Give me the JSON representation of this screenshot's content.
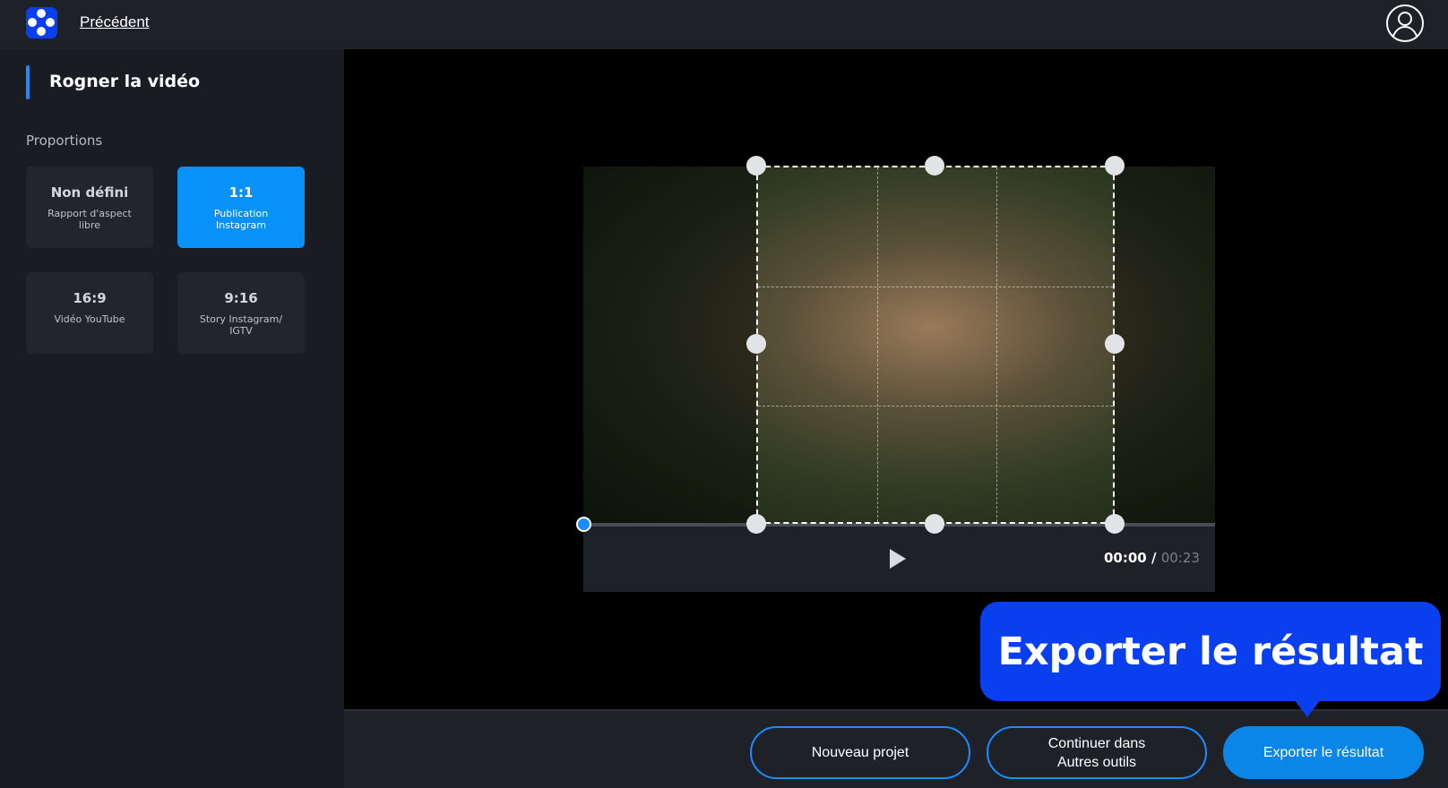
{
  "header": {
    "back_label": "Précédent"
  },
  "sidebar": {
    "title": "Rogner la vidéo",
    "section_label": "Proportions",
    "options": [
      {
        "ratio": "Non défini",
        "desc": "Rapport d'aspect libre",
        "selected": false
      },
      {
        "ratio": "1:1",
        "desc": "Publication Instagram",
        "selected": true
      },
      {
        "ratio": "16:9",
        "desc": "Vidéo YouTube",
        "selected": false
      },
      {
        "ratio": "9:16",
        "desc": "Story Instagram/ IGTV",
        "selected": false
      }
    ]
  },
  "player": {
    "current_time": "00:00",
    "separator": " / ",
    "duration": "00:23",
    "progress": 0
  },
  "tooltip": {
    "text": "Exporter le résultat"
  },
  "footer": {
    "new_project": "Nouveau projet",
    "continue_line1": "Continuer dans",
    "continue_line2": "Autres outils",
    "export": "Exporter le résultat"
  },
  "colors": {
    "accent": "#0891f8",
    "brand": "#0a3ff0",
    "background": "#1a1c23"
  }
}
